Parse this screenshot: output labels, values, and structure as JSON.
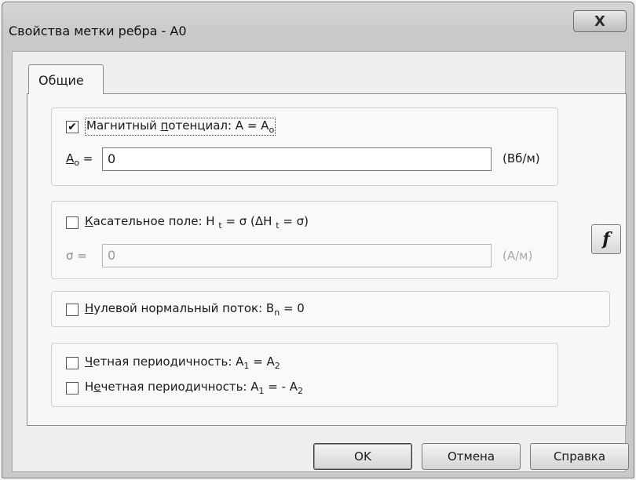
{
  "window": {
    "title": "Свойства метки ребра - A0",
    "close_label": "X"
  },
  "tabs": [
    {
      "label": "Общие"
    }
  ],
  "magnetic": {
    "checked": true,
    "check_mark": "✔",
    "label_pre": "Магнитный ",
    "label_u": "п",
    "label_post": "отенциал: A = A",
    "label_sub": "o",
    "field_u": "A",
    "field_sub": "o",
    "field_eq": " =",
    "value": "0",
    "unit": "(Вб/м)"
  },
  "tangential": {
    "checked": false,
    "label_u": "К",
    "label_a": "асательное поле: H ",
    "label_sub1": "t",
    "label_b": " = σ (ΔH ",
    "label_sub2": "t",
    "label_c": " = σ)",
    "field_label": "σ =",
    "value": "0",
    "unit": "(А/м)"
  },
  "zero_flux": {
    "checked": false,
    "label_u": "Н",
    "label_a": "улевой нормальный поток: B",
    "label_sub": "n",
    "label_b": " = 0"
  },
  "even_periodicity": {
    "checked": false,
    "label_u": "Ч",
    "label_a": "етная периодичность: A",
    "label_sub1": "1",
    "label_b": " = A",
    "label_sub2": "2"
  },
  "odd_periodicity": {
    "checked": false,
    "label_pre": "Н",
    "label_u": "е",
    "label_a": "четная периодичность: A",
    "label_sub1": "1",
    "label_b": " = - A",
    "label_sub2": "2"
  },
  "function_button": {
    "icon": "f"
  },
  "buttons": {
    "ok": "OK",
    "cancel": "Отмена",
    "help": "Справка"
  }
}
